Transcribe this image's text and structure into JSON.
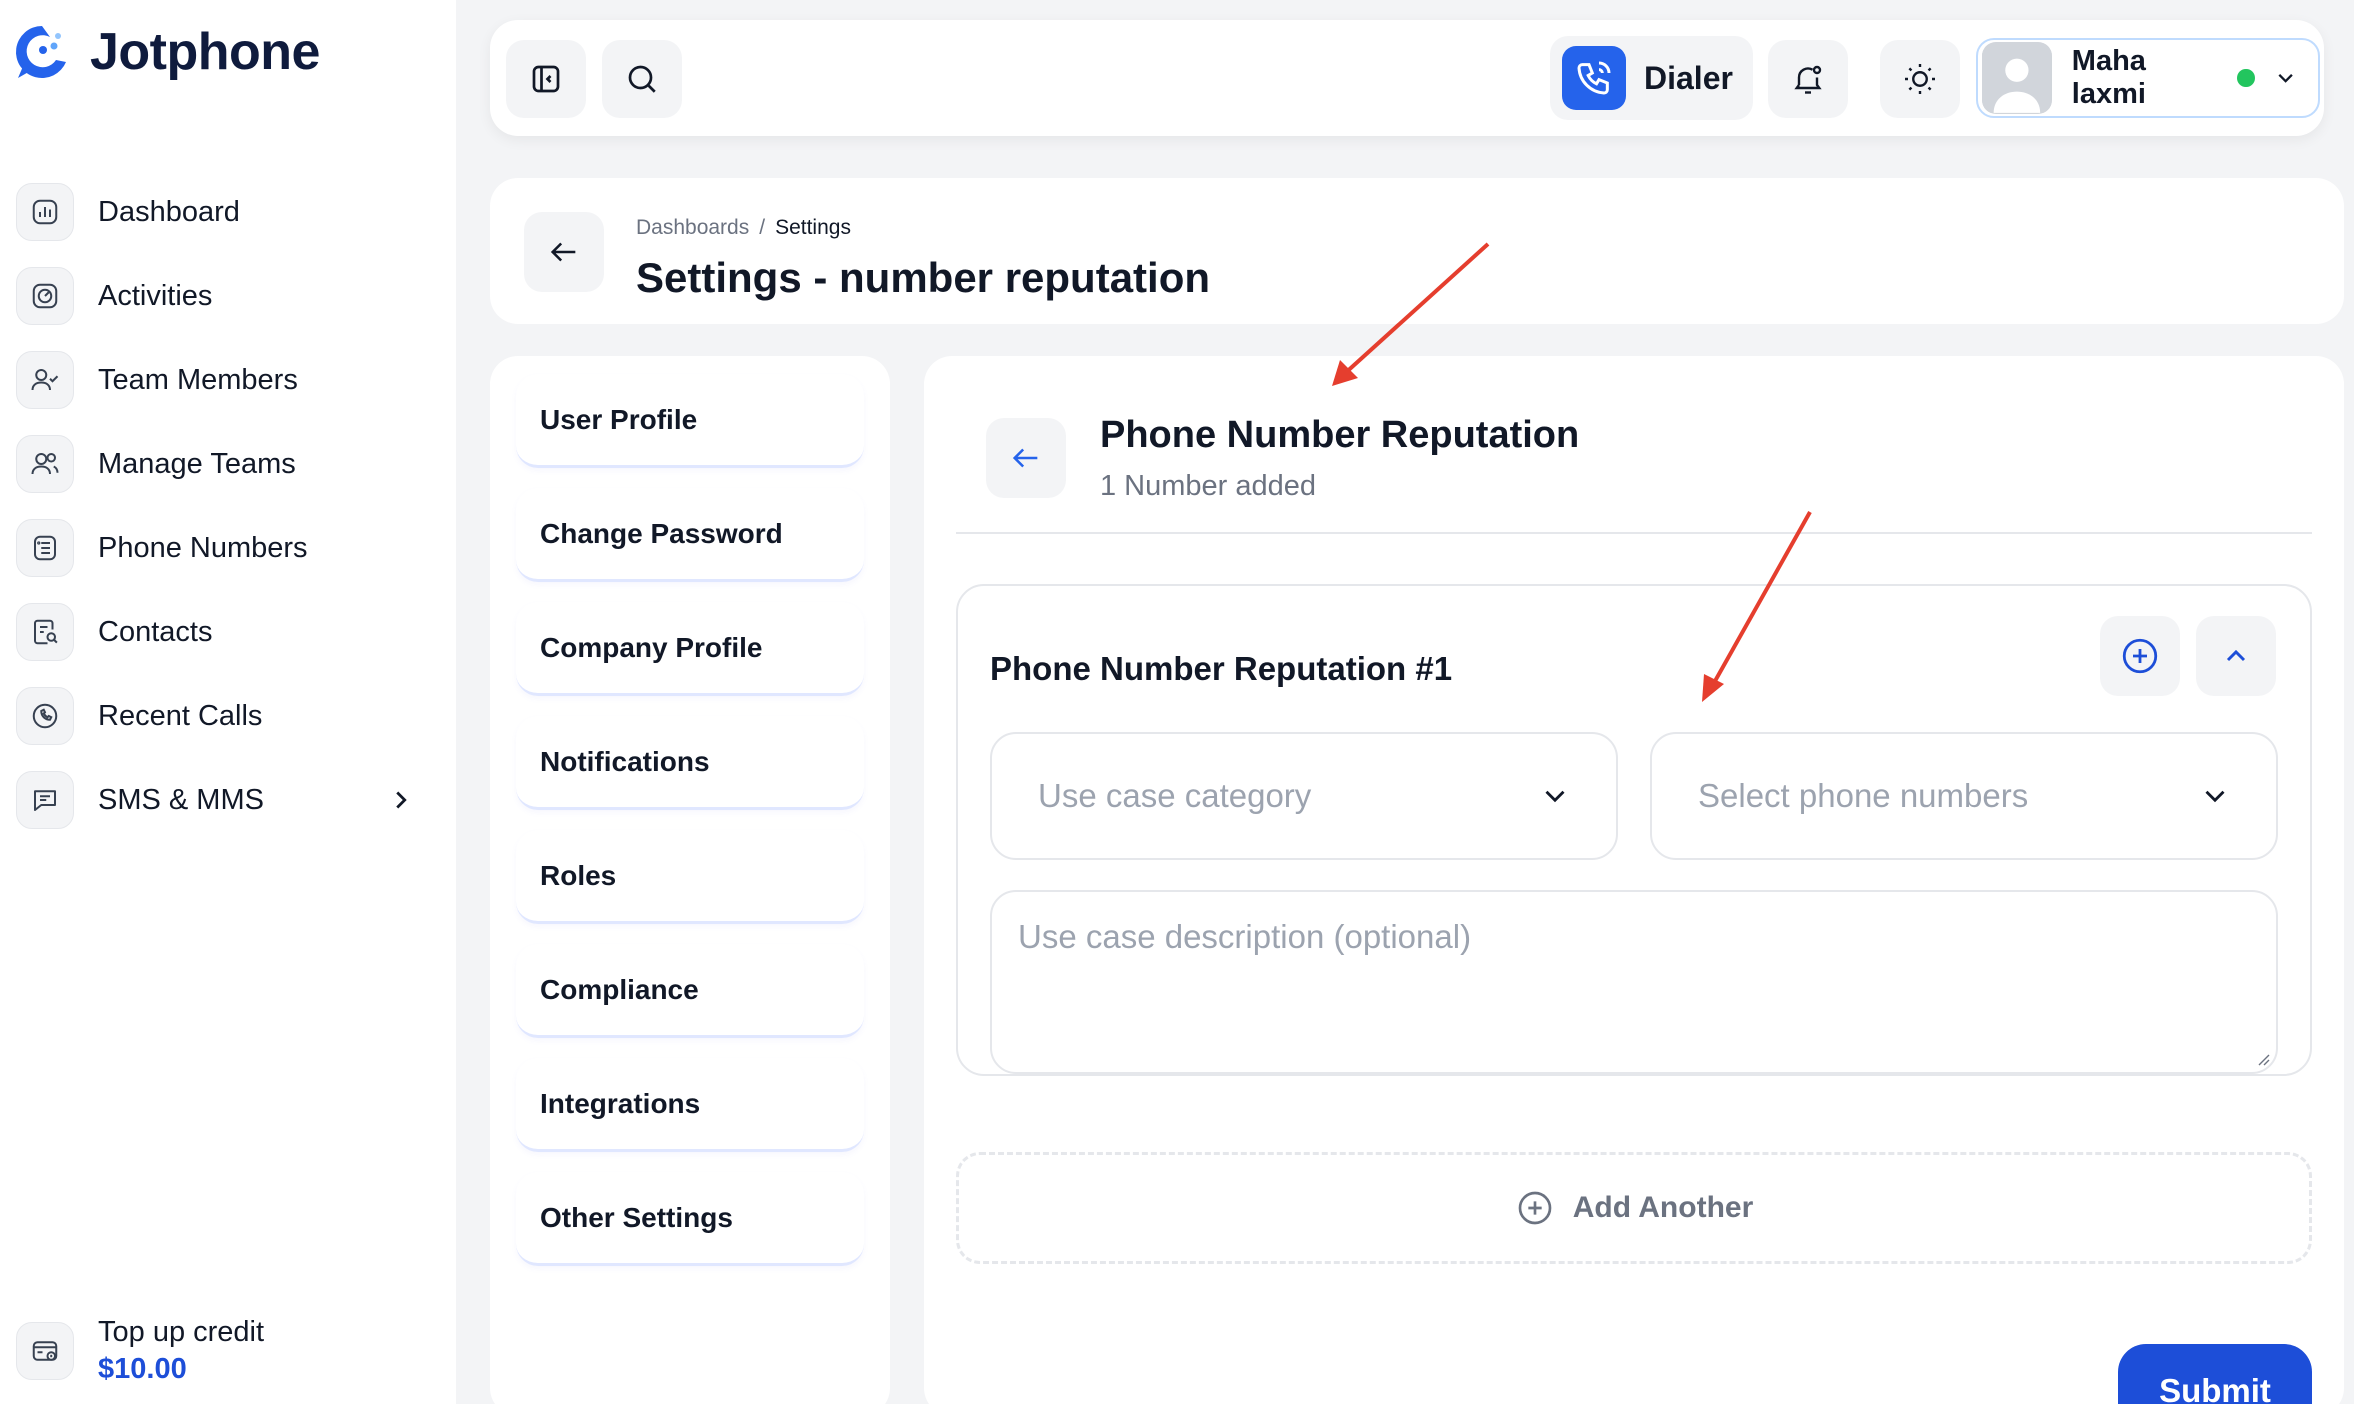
{
  "brand": {
    "name": "Jotphone",
    "accent": "#2563eb"
  },
  "sidebar": {
    "items": [
      {
        "label": "Dashboard",
        "icon": "chart-icon"
      },
      {
        "label": "Activities",
        "icon": "activity-icon"
      },
      {
        "label": "Team Members",
        "icon": "team-members-icon"
      },
      {
        "label": "Manage Teams",
        "icon": "manage-teams-icon"
      },
      {
        "label": "Phone Numbers",
        "icon": "phone-numbers-icon"
      },
      {
        "label": "Contacts",
        "icon": "contacts-icon"
      },
      {
        "label": "Recent Calls",
        "icon": "recent-calls-icon"
      },
      {
        "label": "SMS & MMS",
        "icon": "sms-icon",
        "has_submenu": true
      }
    ],
    "credit": {
      "label": "Top up credit",
      "amount": "$10.00"
    }
  },
  "topbar": {
    "dialer_label": "Dialer",
    "user_name": "Maha laxmi",
    "user_status": "online"
  },
  "header": {
    "breadcrumb": [
      "Dashboards",
      "Settings"
    ],
    "breadcrumb_sep": "/",
    "title": "Settings - number reputation"
  },
  "settings_menu": {
    "items": [
      "User Profile",
      "Change Password",
      "Company Profile",
      "Notifications",
      "Roles",
      "Compliance",
      "Integrations",
      "Other Settings"
    ]
  },
  "main": {
    "title": "Phone Number Reputation",
    "subtitle": "1 Number added",
    "card": {
      "title": "Phone Number Reputation #1",
      "use_case_placeholder": "Use case category",
      "phone_placeholder": "Select phone numbers",
      "description_placeholder": "Use case description (optional)"
    },
    "add_another_label": "Add Another",
    "submit_label": "Submit"
  }
}
